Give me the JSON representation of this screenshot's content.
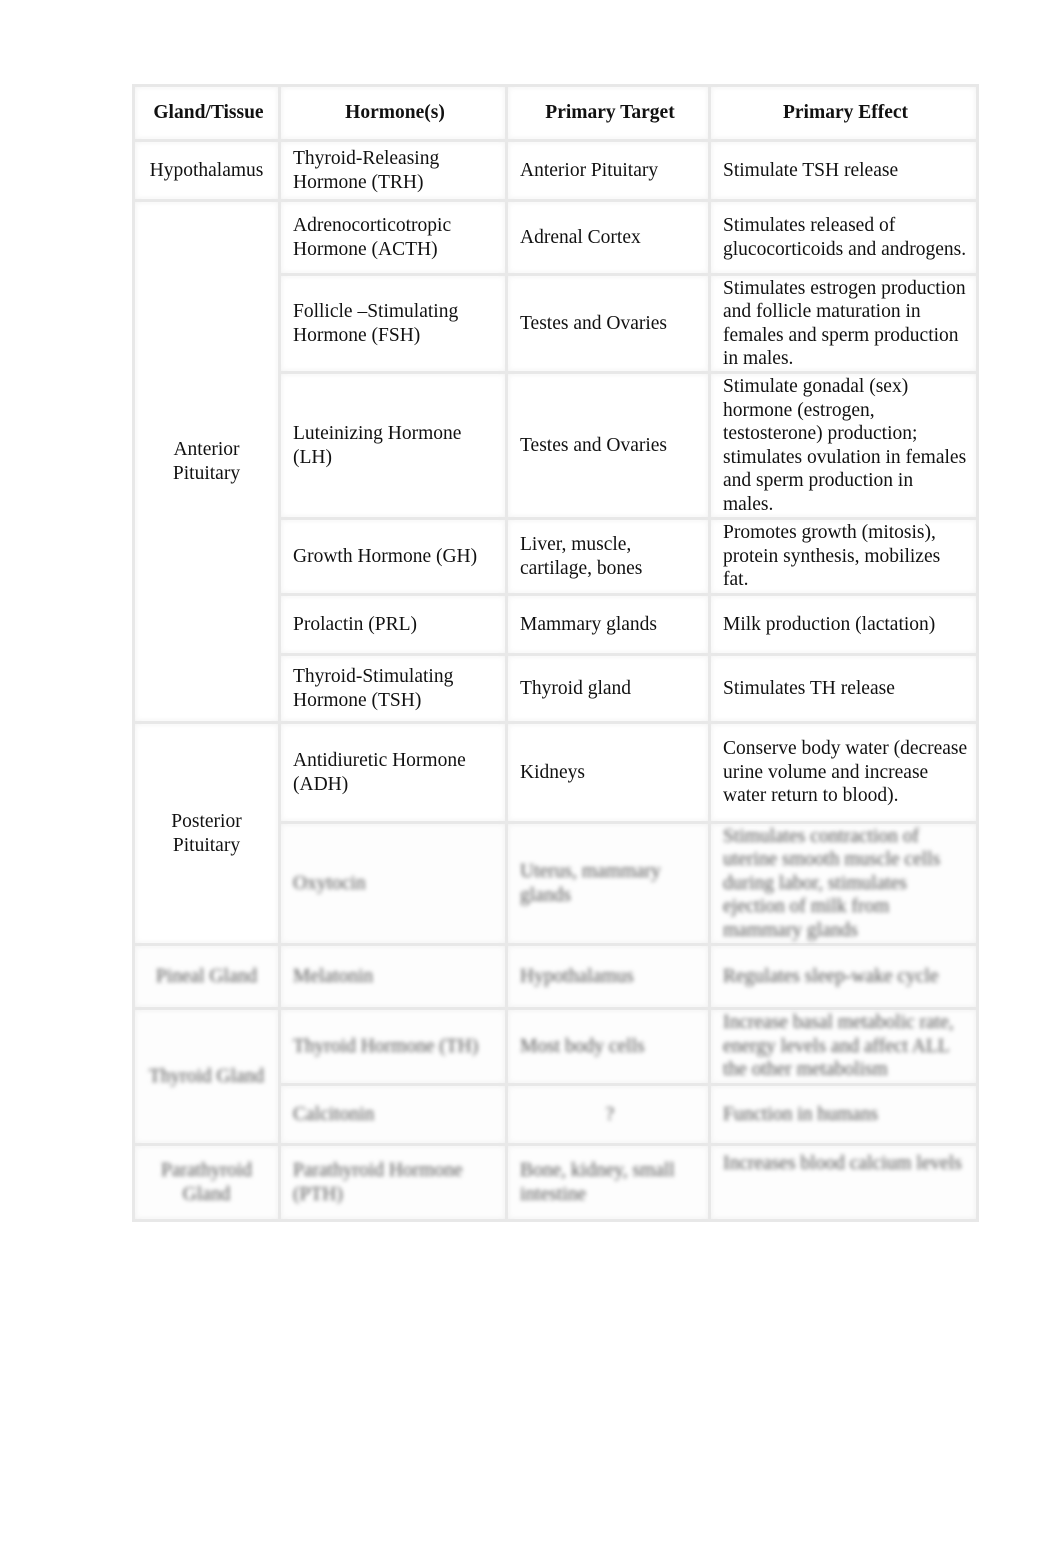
{
  "table": {
    "headers": [
      "Gland/Tissue",
      "Hormone(s)",
      "Primary Target",
      "Primary Effect"
    ],
    "groups": [
      {
        "gland": "Hypothalamus",
        "rows": [
          {
            "hormone": "Thyroid-Releasing Hormone (TRH)",
            "target": "Anterior Pituitary",
            "effect": "Stimulate TSH release"
          }
        ]
      },
      {
        "gland": "Anterior Pituitary",
        "rows": [
          {
            "hormone": "Adrenocorticotropic Hormone (ACTH)",
            "target": "Adrenal Cortex",
            "effect": "Stimulates released of glucocorticoids and androgens."
          },
          {
            "hormone": "Follicle –Stimulating Hormone (FSH)",
            "target": "Testes and Ovaries",
            "effect": "Stimulates estrogen production and follicle maturation in females and sperm production in males."
          },
          {
            "hormone": "Luteinizing Hormone (LH)",
            "target": "Testes and Ovaries",
            "effect": "Stimulate gonadal (sex) hormone (estrogen, testosterone) production; stimulates ovulation in females and sperm production in males."
          },
          {
            "hormone": "Growth Hormone (GH)",
            "target": "Liver, muscle, cartilage, bones",
            "effect": "Promotes growth (mitosis), protein synthesis, mobilizes fat."
          },
          {
            "hormone": "Prolactin (PRL)",
            "target": "Mammary glands",
            "effect": "Milk production (lactation)"
          },
          {
            "hormone": "Thyroid-Stimulating Hormone (TSH)",
            "target": "Thyroid gland",
            "effect": "Stimulates TH release"
          }
        ]
      },
      {
        "gland": "Posterior Pituitary",
        "rows": [
          {
            "hormone": "Antidiuretic Hormone (ADH)",
            "target": "Kidneys",
            "effect": "Conserve body water (decrease urine volume and increase water return to blood)."
          },
          {
            "hormone": "Oxytocin",
            "target": "Uterus, mammary glands",
            "effect": "Stimulates contraction of uterine smooth muscle cells during labor, stimulates ejection of milk from mammary glands",
            "blurred": true
          }
        ]
      },
      {
        "gland": "Pineal Gland",
        "blurred": true,
        "rows": [
          {
            "hormone": "Melatonin",
            "target": "Hypothalamus",
            "effect": "Regulates sleep-wake cycle",
            "blurred": true
          }
        ]
      },
      {
        "gland": "Thyroid Gland",
        "blurred": true,
        "rows": [
          {
            "hormone": "Thyroid Hormone (TH)",
            "target": "Most body cells",
            "effect": "Increase basal metabolic rate, energy levels and affect ALL the other metabolism",
            "blurred": true
          },
          {
            "hormone": "Calcitonin",
            "target": "?",
            "effect": "Function in humans",
            "blurred": true
          }
        ]
      },
      {
        "gland": "Parathyroid Gland",
        "blurred": true,
        "rows": [
          {
            "hormone": "Parathyroid Hormone (PTH)",
            "target": "Bone, kidney, small intestine",
            "effect": "Increases blood calcium levels",
            "blurred": true
          }
        ]
      }
    ]
  }
}
